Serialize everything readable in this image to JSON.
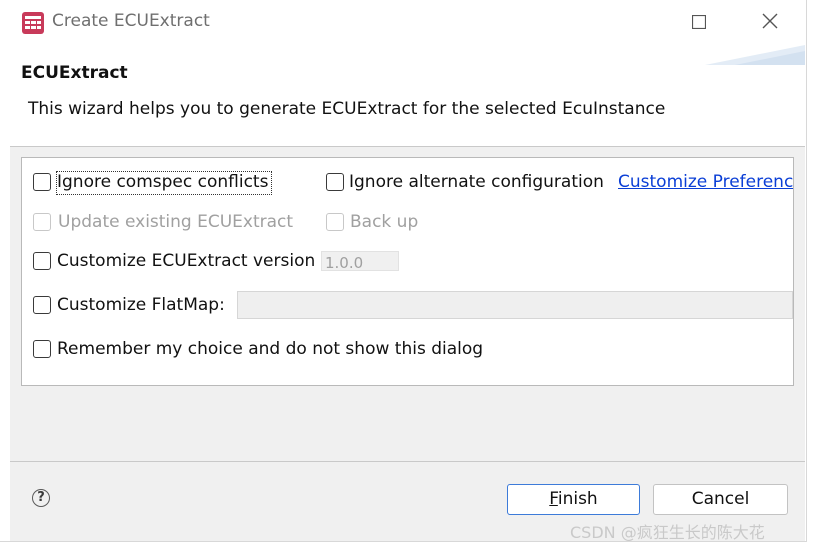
{
  "window": {
    "title": "Create ECUExtract",
    "controls": {
      "maximize": "maximize-icon",
      "close": "close-icon"
    }
  },
  "header": {
    "title": "ECUExtract",
    "description": "This wizard helps you to generate ECUExtract for the selected EcuInstance"
  },
  "options": {
    "ignore_comspec": {
      "label": "Ignore comspec conflicts",
      "checked": false,
      "enabled": true
    },
    "ignore_alternate": {
      "label": "Ignore alternate configuration",
      "checked": false,
      "enabled": true
    },
    "customize_link": "Customize Preferenc",
    "update_existing": {
      "label": "Update existing ECUExtract",
      "checked": false,
      "enabled": false
    },
    "back_up": {
      "label": "Back up",
      "checked": false,
      "enabled": false
    },
    "customize_version": {
      "label": "Customize ECUExtract version",
      "checked": false,
      "enabled": true,
      "value": "1.0.0"
    },
    "customize_flatmap": {
      "label": "Customize FlatMap:",
      "checked": false,
      "enabled": true,
      "value": ""
    },
    "remember_choice": {
      "label": "Remember my choice and do not show this dialog",
      "checked": false,
      "enabled": true
    }
  },
  "footer": {
    "help_icon": "help-icon",
    "finish_label": "Finish",
    "cancel_label": "Cancel"
  },
  "watermark": "CSDN @疯狂生长的陈大花"
}
